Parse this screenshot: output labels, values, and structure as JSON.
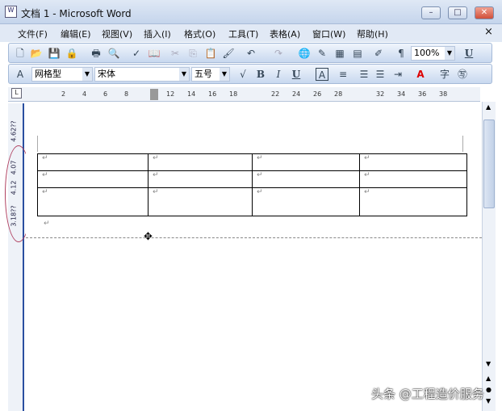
{
  "window": {
    "title": "文档 1 - Microsoft Word",
    "minimize": "–",
    "maximize": "□",
    "close": "✕"
  },
  "menu": [
    "文件(F)",
    "编辑(E)",
    "视图(V)",
    "插入(I)",
    "格式(O)",
    "工具(T)",
    "表格(A)",
    "窗口(W)",
    "帮助(H)"
  ],
  "menu_close": "×",
  "toolbar": {
    "zoom": "100%",
    "underline": "U"
  },
  "format": {
    "style": "网格型",
    "font": "宋体",
    "size": "五号",
    "bold": "B",
    "italic": "I",
    "underline": "U",
    "font_color": "A"
  },
  "ruler": [
    "2",
    "4",
    "6",
    "8",
    "12",
    "14",
    "16",
    "18",
    "22",
    "24",
    "26",
    "28",
    "32",
    "34",
    "36",
    "38"
  ],
  "vruler": [
    "4.62??",
    "4.07",
    "4.12",
    "3.18??"
  ],
  "table": {
    "rows": 3,
    "cols": 4,
    "mark": "↵"
  },
  "para_mark": "↵",
  "watermark": "头条 @工程造价服务"
}
